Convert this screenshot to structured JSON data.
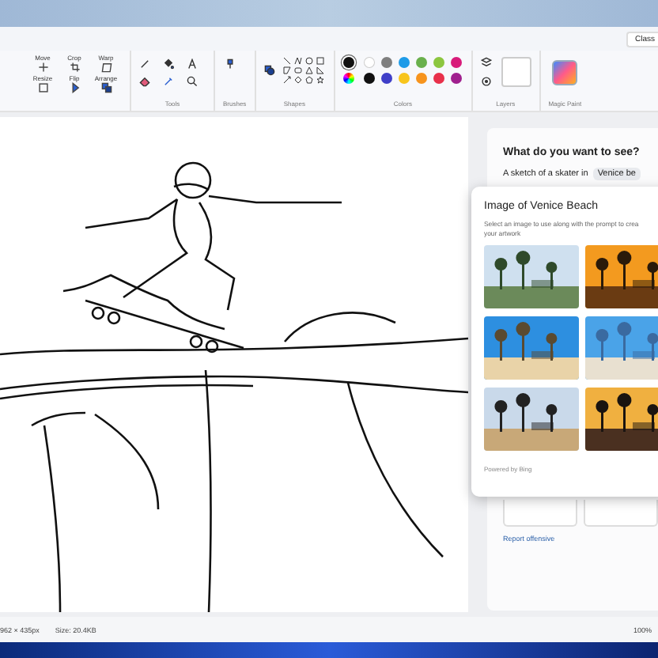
{
  "window": {
    "title_button": "Class"
  },
  "ribbon": {
    "image_tools": [
      {
        "label": "Move"
      },
      {
        "label": "Crop"
      },
      {
        "label": "Warp"
      },
      {
        "label": "Resize"
      },
      {
        "label": "Flip"
      },
      {
        "label": "Arrange"
      }
    ],
    "groups": [
      {
        "label": "Tools"
      },
      {
        "label": "Brushes"
      },
      {
        "label": "Shapes"
      },
      {
        "label": "Colors"
      },
      {
        "label": "Layers"
      },
      {
        "label": "Magic Paint"
      }
    ],
    "colors": [
      {
        "color": "#111111",
        "selected": true
      },
      {
        "color": "#ffffff",
        "selected": false
      },
      {
        "color": "#7f7f7f",
        "selected": false
      },
      {
        "color": "#1e9be8",
        "selected": false
      },
      {
        "color": "#6ab04c",
        "selected": false
      },
      {
        "color": "#8cc63f",
        "selected": false
      },
      {
        "color": "#d81b7a",
        "selected": false
      },
      {
        "color": "#111111",
        "selected": false
      },
      {
        "color": "#3f3fc8",
        "selected": false
      },
      {
        "color": "#f8c51c",
        "selected": false
      },
      {
        "color": "#f7941d",
        "selected": false
      },
      {
        "color": "#e8304a",
        "selected": false
      },
      {
        "color": "#a0208e",
        "selected": false
      }
    ]
  },
  "panel": {
    "heading": "What do you want to see?",
    "prompt": "A sketch of a skater in",
    "prompt_chip": "Venice be",
    "report_link": "Report offensive"
  },
  "popup": {
    "title": "Image of Venice Beach",
    "description_lines": [
      "Select an image to use along with the prompt to crea",
      "your artwork"
    ],
    "footer": "Powered by Bing"
  },
  "status_bar": {
    "dimensions": "962 × 435px",
    "size": "Size: 20.4KB",
    "zoom": "100%"
  }
}
